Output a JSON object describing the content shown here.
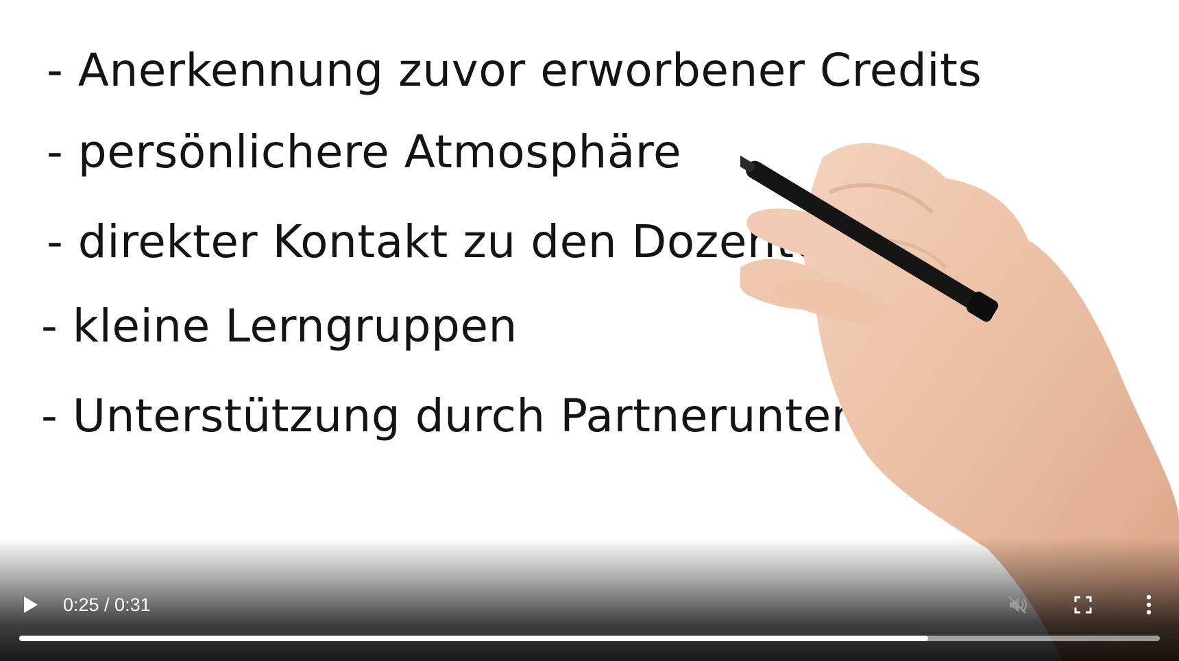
{
  "video": {
    "lines": [
      "- Anerkennung zuvor erworbener Credits",
      "- persönlichere Atmosphäre",
      "- direkter Kontakt zu den Dozenten",
      "- kleine Lerngruppen",
      "- Unterstützung durch Partnerunternehm"
    ]
  },
  "controls": {
    "time": "0:25 / 0:31",
    "progress_fraction": 0.7966,
    "play_icon": "play-icon",
    "mute_icon": "muted-icon",
    "fullscreen_icon": "fullscreen-icon",
    "more_icon": "more-vertical-icon"
  }
}
